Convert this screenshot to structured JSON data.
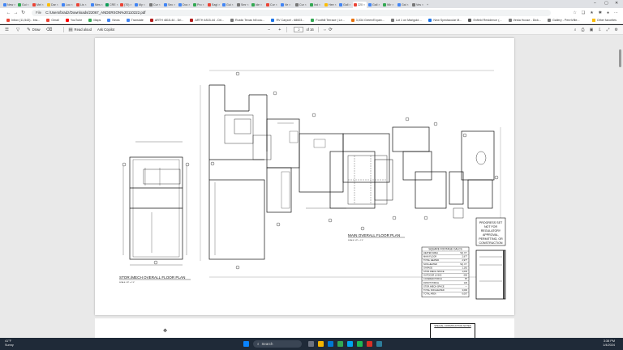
{
  "browser": {
    "tabs": [
      {
        "label": "New",
        "color": "#4285f4"
      },
      {
        "label": "Gui",
        "color": "#34a853"
      },
      {
        "label": "Mel",
        "color": "#ea4335"
      },
      {
        "label": "Dar",
        "color": "#fbbc05"
      },
      {
        "label": "Loc",
        "color": "#4285f4"
      },
      {
        "label": "Lis",
        "color": "#ea4335"
      },
      {
        "label": "Mes",
        "color": "#4285f4"
      },
      {
        "label": "CRE",
        "color": "#0f9d58"
      },
      {
        "label": "(70)",
        "color": "#ea4335"
      },
      {
        "label": "My",
        "color": "#4285f4"
      },
      {
        "label": "Cur",
        "color": "#777777"
      },
      {
        "label": "Sec",
        "color": "#4285f4"
      },
      {
        "label": "Doc",
        "color": "#4285f4"
      },
      {
        "label": "Pro",
        "color": "#34a853"
      },
      {
        "label": "Eagl",
        "color": "#ea4335"
      },
      {
        "label": "Gui",
        "color": "#4285f4"
      },
      {
        "label": "Smr",
        "color": "#777777"
      },
      {
        "label": "Ide",
        "color": "#34a853"
      },
      {
        "label": "Cur",
        "color": "#ea4335"
      },
      {
        "label": "Ve",
        "color": "#4285f4"
      },
      {
        "label": "Cur",
        "color": "#777777"
      },
      {
        "label": "Ind",
        "color": "#34a853"
      },
      {
        "label": "Hee",
        "color": "#fbbc05"
      },
      {
        "label": "Gall",
        "color": "#4285f4"
      },
      {
        "label": "220",
        "color": "#ea4335"
      },
      {
        "label": "Gall",
        "color": "#4285f4"
      },
      {
        "label": "Wir",
        "color": "#34a853"
      },
      {
        "label": "Gal",
        "color": "#4285f4"
      },
      {
        "label": "Ves",
        "color": "#777777"
      }
    ],
    "active_tab_index": 24,
    "new_tab": "+",
    "address": {
      "scheme": "File",
      "url": "C:/Users/bradz/Downloads/22067_ANDERSON%20110222.pdf"
    },
    "bookmarks": [
      {
        "label": "Inbox (11,543) - bra...",
        "color": "#ea4335"
      },
      {
        "label": "Gmail",
        "color": "#ea4335"
      },
      {
        "label": "YouTube",
        "color": "#ff0000"
      },
      {
        "label": "Maps",
        "color": "#34a853"
      },
      {
        "label": "News",
        "color": "#4285f4"
      },
      {
        "label": "Translate",
        "color": "#4285f4"
      },
      {
        "label": "ARTH 4815-44 - Dri...",
        "color": "#b31b1b"
      },
      {
        "label": "ARTH 4815-44 - Dri...",
        "color": "#b31b1b"
      },
      {
        "label": "Rustic Texas hill cou...",
        "color": "#777777"
      },
      {
        "label": "RV Carport - 68603...",
        "color": "#1a73e8"
      },
      {
        "label": "Foothill Terrace | Le...",
        "color": "#34a853"
      },
      {
        "label": "3,034 Green/Expan...",
        "color": "#e8710a"
      },
      {
        "label": "Lot 1 on Marigold ...",
        "color": "#777777"
      },
      {
        "label": "New Spectacular M...",
        "color": "#1a73e8"
      },
      {
        "label": "Enfield Residence (...",
        "color": "#555555"
      },
      {
        "label": "Vesta House - Dick...",
        "color": "#777777"
      },
      {
        "label": "Gallery - PennVille...",
        "color": "#777777"
      }
    ],
    "other_favorites": "Other favorites"
  },
  "pdf_toolbar": {
    "draw_label": "Draw",
    "read_aloud": "Read aloud",
    "ask_copilot": "Ask Copilot",
    "zoom_out": "−",
    "zoom_in": "+",
    "current_page": "2",
    "page_total": "of 16"
  },
  "drawing": {
    "main_title": "MAIN OVERALL FLOOR PLAN",
    "main_scale": "SCALE: 1/8\" = 1'-0\"",
    "stor_title": "STOR./MECH OVERALL FLOOR PLAN",
    "stor_scale": "SCALE: 1/8\" = 1'-0\"",
    "stamp_lines": [
      "PROGRESS SET",
      "NOT FOR",
      "REGULATORY",
      "APPROVAL,",
      "PERMITTING, OR",
      "CONSTRUCTION"
    ],
    "sqft_title": "SQUARE FOOTAGE CALCS",
    "sqft_rows": [
      [
        "HEATED AREA",
        "SQ. FT."
      ],
      [
        "MAIN FLOOR",
        "2,977"
      ],
      [
        "TOTAL HEATED",
        "2,977"
      ],
      [
        "NON-HEATED",
        "SQ. FT."
      ],
      [
        "GARAGE",
        "1,181"
      ],
      [
        "STOR./MECH SPACE",
        "1,003"
      ],
      [
        "OUTDOOR LIVING",
        "690"
      ],
      [
        "COVERED PORCH",
        "87"
      ],
      [
        "FRONT PORCH",
        "129"
      ],
      [
        "STOR./MECH SPACE",
        "---"
      ],
      [
        "TOTAL NON-HEATED",
        "3,090"
      ],
      [
        "TOTAL AREA",
        "6,067"
      ]
    ],
    "page2_note": "SPECIAL CONSTRUCTION NOTES"
  },
  "taskbar": {
    "weather_temp": "41°F",
    "weather_desc": "Sunny",
    "search_placeholder": "Search",
    "time": "3:38 PM",
    "date": "1/4/2024"
  }
}
